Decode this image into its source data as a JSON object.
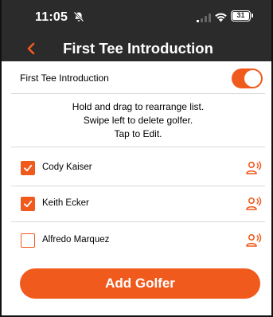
{
  "status_bar": {
    "time": "11:05",
    "battery": "31",
    "icons": [
      "bell-slash-icon",
      "signal-icon",
      "wifi-icon",
      "battery-icon"
    ]
  },
  "header": {
    "title": "First Tee Introduction",
    "back_icon": "chevron-left-icon"
  },
  "settings": {
    "toggle_label": "First Tee Introduction",
    "toggle_on": true
  },
  "instructions": [
    "Hold and drag to rearrange list.",
    "Swipe left to delete golfer.",
    "Tap to Edit."
  ],
  "golfers": [
    {
      "name": "Cody Kaiser",
      "checked": true
    },
    {
      "name": "Keith Ecker",
      "checked": true
    },
    {
      "name": "Alfredo Marquez",
      "checked": false
    }
  ],
  "actions": {
    "add_golfer_label": "Add Golfer"
  },
  "colors": {
    "accent": "#f15a1d",
    "header_bg": "#2b2b2b"
  }
}
